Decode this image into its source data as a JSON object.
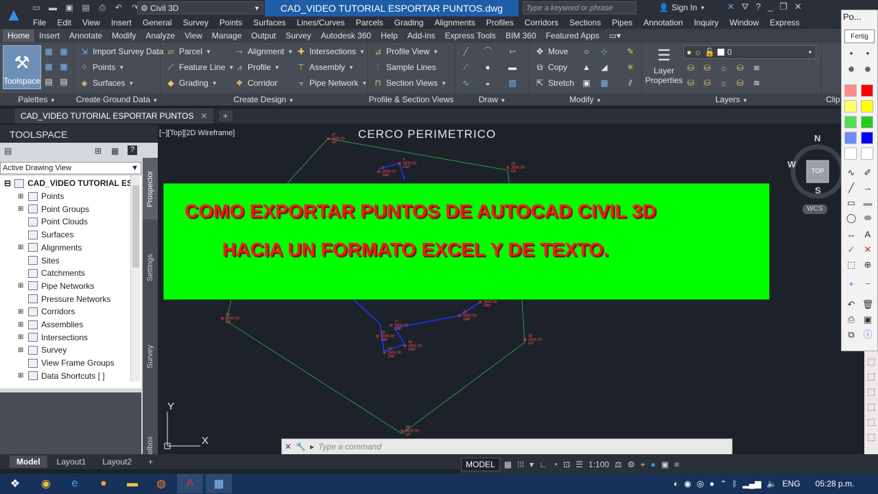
{
  "app": {
    "title": "CAD_VIDEO TUTORIAL ESPORTAR PUNTOS.dwg",
    "workspace": "Civil 3D",
    "logo_text": "C3D",
    "search_placeholder": "Type a keyword or phrase",
    "signin": "Sign In"
  },
  "menubar": [
    "File",
    "Edit",
    "View",
    "Insert",
    "General",
    "Survey",
    "Points",
    "Surfaces",
    "Lines/Curves",
    "Parcels",
    "Grading",
    "Alignments",
    "Profiles",
    "Corridors",
    "Sections",
    "Pipes",
    "Annotation",
    "Inquiry",
    "Window",
    "Express"
  ],
  "ribbon_tabs": [
    "Home",
    "Insert",
    "Annotate",
    "Modify",
    "Analyze",
    "View",
    "Manage",
    "Output",
    "Survey",
    "Autodesk 360",
    "Help",
    "Add-ins",
    "Express Tools",
    "BIM 360",
    "Featured Apps"
  ],
  "ribbon": {
    "palettes": {
      "title": "Palettes",
      "toolspace": "Toolspace"
    },
    "create_ground": {
      "title": "Create Ground Data",
      "items": [
        "Import Survey Data",
        "Points",
        "Surfaces"
      ]
    },
    "create_design": {
      "title": "Create Design",
      "items": [
        "Parcel",
        "Feature Line",
        "Grading",
        "Alignment",
        "Profile",
        "Corridor",
        "Intersections",
        "Assembly",
        "Pipe Network"
      ]
    },
    "profile_section": {
      "title": "Profile & Section Views",
      "items": [
        "Profile View",
        "Sample Lines",
        "Section Views"
      ]
    },
    "draw": {
      "title": "Draw"
    },
    "modify": {
      "title": "Modify",
      "items": [
        "Move",
        "Copy",
        "Stretch"
      ]
    },
    "layers": {
      "title": "Layers",
      "layer_properties": "Layer Properties",
      "current_layer": "0"
    },
    "clip": "Clip"
  },
  "doc_tab": "CAD_VIDEO TUTORIAL ESPORTAR PUNTOS",
  "toolspace": {
    "title": "TOOLSPACE",
    "view": "Active Drawing View",
    "root": "CAD_VIDEO TUTORIAL ES...",
    "items": [
      "Points",
      "Point Groups",
      "Point Clouds",
      "Surfaces",
      "Alignments",
      "Sites",
      "Catchments",
      "Pipe Networks",
      "Pressure Networks",
      "Corridors",
      "Assemblies",
      "Intersections",
      "Survey",
      "View Frame Groups",
      "Data Shortcuts [ ]"
    ],
    "side_tabs": [
      "Prospector",
      "Settings",
      "Survey",
      "Toolbox"
    ]
  },
  "viewport": {
    "label": "[−][Top][2D Wireframe]",
    "drawing_title": "CERCO  PERIMETRICO",
    "banner_line1": "COMO EXPORTAR PUNTOS DE AUTOCAD CIVIL 3D",
    "banner_line2": "HACIA UN FORMATO EXCEL Y DE TEXTO.",
    "banner_color": "#00ff00",
    "text_color": "#e8201c",
    "compass": {
      "n": "N",
      "s": "S",
      "w": "W",
      "top": "TOP",
      "wcs": "WCS"
    },
    "points": [
      {
        "num": "27",
        "elev": "2600.00",
        "code": "GP"
      },
      {
        "num": "4",
        "elev": "2600.00",
        "code": "ZAP"
      },
      {
        "num": "3",
        "elev": "2600.00",
        "code": "ZAP"
      },
      {
        "num": "24",
        "elev": "2600.00",
        "code": "GP"
      },
      {
        "num": "26",
        "elev": "2600.00",
        "code": "GP"
      },
      {
        "num": "17",
        "elev": "2600.00",
        "code": "ZAP"
      },
      {
        "num": "18",
        "elev": "2600.00",
        "code": "ZAP"
      },
      {
        "num": "20",
        "elev": "2600.00",
        "code": "ZAP"
      },
      {
        "num": "19",
        "elev": "2600.00",
        "code": "ZAP"
      },
      {
        "num": "21",
        "elev": "2600.00",
        "code": "ZAP"
      },
      {
        "num": "22",
        "elev": "2600.00",
        "code": "ZAP"
      },
      {
        "num": "30",
        "elev": "2600.00",
        "code": "GP"
      },
      {
        "num": "28",
        "elev": "2600.00",
        "code": "GP"
      }
    ],
    "axis_x": "X",
    "axis_y": "Y"
  },
  "command": {
    "placeholder": "Type  a  command"
  },
  "layout_tabs": [
    "Model",
    "Layout1",
    "Layout2"
  ],
  "status": {
    "model": "MODEL",
    "scale": "1:100"
  },
  "tray": {
    "lang": "ENG",
    "time": "05:28 p.m."
  },
  "palette": {
    "title": "Po...",
    "done": "Fertig",
    "colors": [
      "#ff6b6b",
      "#ffff00",
      "#22dd22",
      "#1a3cff",
      "#ffffff",
      "#ff0000"
    ]
  }
}
